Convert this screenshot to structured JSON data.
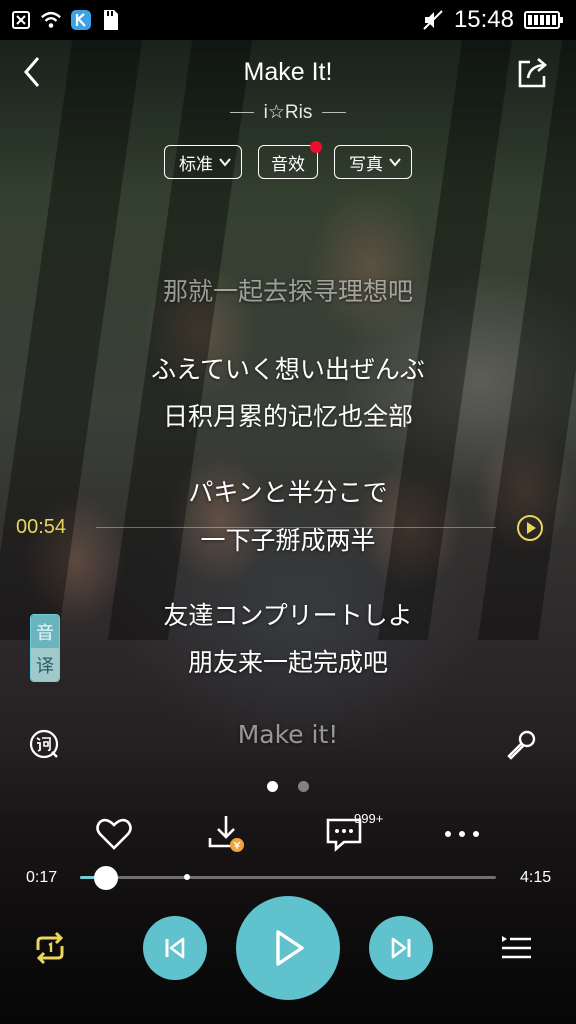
{
  "status_bar": {
    "time": "15:48",
    "icons": [
      "sim-error-icon",
      "wifi-icon",
      "kuwo-app-icon",
      "sd-card-icon",
      "mute-icon",
      "battery-icon"
    ]
  },
  "header": {
    "title": "Make It!",
    "artist": "i☆Ris",
    "chips": [
      {
        "label": "标准",
        "has_dropdown": true
      },
      {
        "label": "音效",
        "has_badge": true
      },
      {
        "label": "写真",
        "has_dropdown": true
      }
    ]
  },
  "lyrics": {
    "lines": [
      {
        "text": "那就一起去探寻理想吧",
        "style": "dim"
      },
      {
        "text": "ふえていく想い出ぜんぶ",
        "style": "normal"
      },
      {
        "text": "日积月累的记忆也全部",
        "style": "normal"
      },
      {
        "text": "パキンと半分こで",
        "style": "normal"
      },
      {
        "text": "一下子掰成两半",
        "style": "normal"
      },
      {
        "text": "友達コンプリートしよ",
        "style": "normal"
      },
      {
        "text": "朋友来一起完成吧",
        "style": "normal"
      },
      {
        "text": "Make it!",
        "style": "dim"
      }
    ],
    "seek_time": "00:54",
    "badge_top": "音",
    "badge_bottom": "译"
  },
  "page_indicator": {
    "count": 2,
    "active": 0
  },
  "actions": {
    "comment_count": "999+"
  },
  "progress": {
    "current": "0:17",
    "total": "4:15",
    "fraction": 0.063
  },
  "colors": {
    "accent": "#5fc2cc",
    "highlight": "#e9d65a",
    "badge_red": "#e8102a"
  }
}
